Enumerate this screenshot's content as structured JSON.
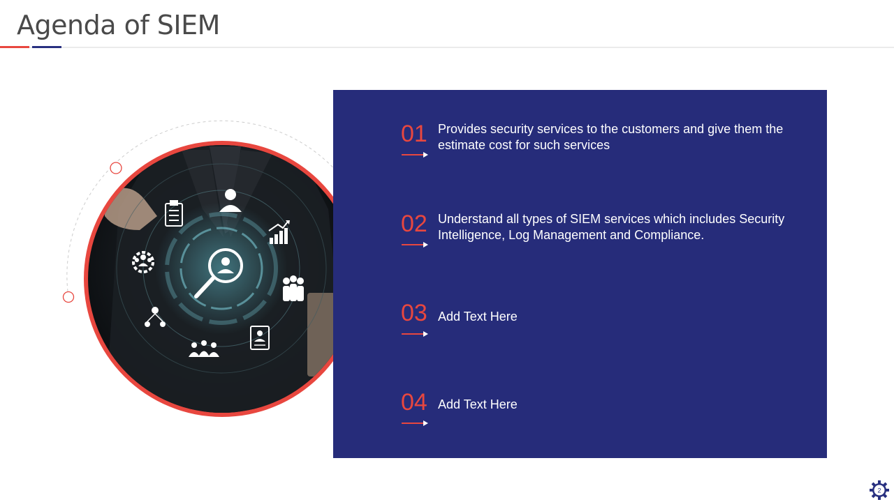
{
  "page": {
    "title": "Agenda of SIEM",
    "page_number": "2"
  },
  "agenda": {
    "items": [
      {
        "number": "01",
        "text": "Provides security services to the customers and give them the estimate cost for such services"
      },
      {
        "number": "02",
        "text": "Understand all types of SIEM services which includes Security Intelligence, Log Management and Compliance."
      },
      {
        "number": "03",
        "text": "Add Text Here"
      },
      {
        "number": "04",
        "text": "Add Text Here"
      }
    ]
  },
  "colors": {
    "accent_red": "#e8473f",
    "accent_blue": "#283080",
    "panel": "#262c7a"
  },
  "icons": [
    "user-search-icon",
    "clipboard-icon",
    "person-icon",
    "growth-chart-icon",
    "team-gear-icon",
    "group-icon",
    "network-icon",
    "team-icon",
    "id-card-icon",
    "gear-icon"
  ]
}
